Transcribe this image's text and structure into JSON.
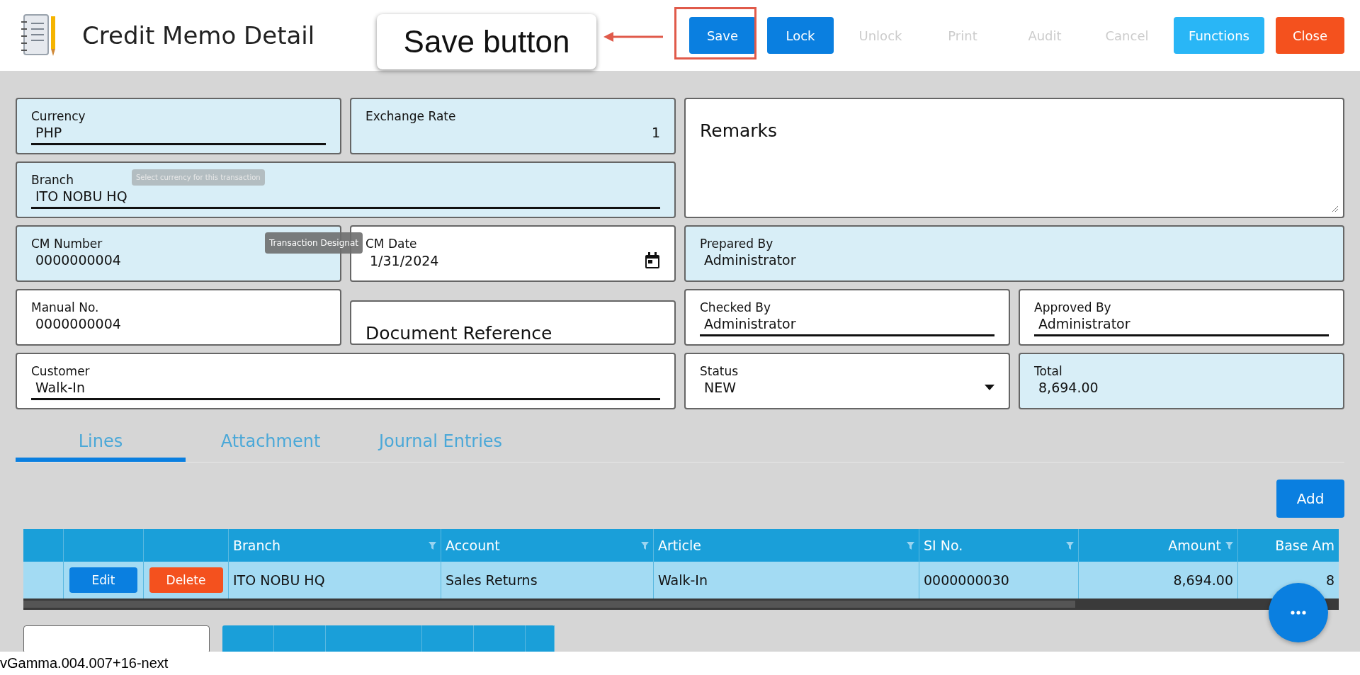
{
  "header": {
    "title": "Credit Memo Detail",
    "buttons": [
      {
        "label": "Save",
        "kind": "primary"
      },
      {
        "label": "Lock",
        "kind": "primary"
      },
      {
        "label": "Unlock",
        "kind": "disabled"
      },
      {
        "label": "Print",
        "kind": "disabled"
      },
      {
        "label": "Audit",
        "kind": "disabled"
      },
      {
        "label": "Cancel",
        "kind": "disabled"
      },
      {
        "label": "Functions",
        "kind": "info"
      },
      {
        "label": "Close",
        "kind": "danger"
      }
    ]
  },
  "callout": {
    "text": "Save button"
  },
  "form": {
    "fields": [
      {
        "label": "Currency",
        "value": "PHP",
        "kind": "underline",
        "readonly": true
      },
      {
        "label": "Exchange Rate",
        "value": "1",
        "kind": "number",
        "readonly": true
      },
      {
        "label": "Remarks",
        "kind": "textarea",
        "readonly": false
      },
      {
        "label": "Branch",
        "value": "ITO NOBU HQ",
        "kind": "underline",
        "readonly": true
      },
      {
        "label": "CM Number",
        "value": "0000000004",
        "kind": "plain",
        "readonly": true
      },
      {
        "label": "CM Date",
        "value": "1/31/2024",
        "kind": "date",
        "readonly": false
      },
      {
        "label": "Prepared By",
        "value": "Administrator",
        "kind": "plain",
        "readonly": true
      },
      {
        "label": "Manual No.",
        "value": "0000000004",
        "kind": "plain",
        "readonly": false
      },
      {
        "label": "Document Reference",
        "kind": "big",
        "readonly": false
      },
      {
        "label": "Checked By",
        "value": "Administrator",
        "kind": "underline",
        "readonly": false
      },
      {
        "label": "Approved By",
        "value": "Administrator",
        "kind": "underline",
        "readonly": false
      },
      {
        "label": "Customer",
        "value": "Walk-In",
        "kind": "underline",
        "readonly": false
      },
      {
        "label": "Status",
        "value": "NEW",
        "kind": "select",
        "readonly": false
      },
      {
        "label": "Total",
        "value": "8,694.00",
        "kind": "plain",
        "readonly": true
      }
    ],
    "tooltips": [
      "Select currency for this transaction",
      "Transaction Designat"
    ]
  },
  "tabs": [
    {
      "label": "Lines",
      "selected": true
    },
    {
      "label": "Attachment",
      "selected": false
    },
    {
      "label": "Journal Entries",
      "selected": false
    }
  ],
  "add_button": "Add",
  "grid": {
    "columns": [
      "Branch",
      "Account",
      "Article",
      "SI No.",
      "Amount",
      "Base Am"
    ],
    "rows": [
      {
        "edit": "Edit",
        "delete": "Delete",
        "cells": [
          "ITO NOBU HQ",
          "Sales Returns",
          "Walk-In",
          "0000000030",
          "8,694.00",
          "8"
        ]
      }
    ]
  },
  "footer": {
    "version": "vGamma.004.007+16-next"
  }
}
